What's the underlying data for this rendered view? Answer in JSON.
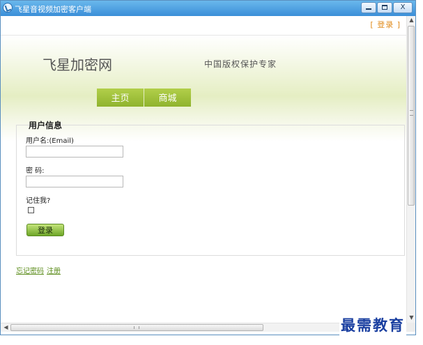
{
  "window": {
    "title": "飞星音视频加密客户端",
    "close_glyph": "X"
  },
  "header": {
    "login_link": "[ 登录 ]",
    "site_title": "飞星加密网",
    "slogan": "中国版权保护专家",
    "nav": [
      {
        "label": "主页"
      },
      {
        "label": "商城"
      }
    ]
  },
  "form": {
    "legend": "用户信息",
    "username_label": "用户名:(Email)",
    "username_value": "",
    "password_label": "密 码:",
    "password_value": "",
    "remember_label": "记住我?",
    "remember_checked": false,
    "login_button": "登录"
  },
  "links": {
    "forgot_password": "忘记密码",
    "register": "注册"
  },
  "scrollbars": {
    "up": "▲",
    "down": "▼",
    "left": "◀",
    "right": "▶"
  },
  "watermark": "最需教育",
  "colors": {
    "accent_green": "#8fb32e",
    "link_orange": "#e08a1a",
    "link_green": "#5b8c1a",
    "titlebar_blue": "#3a8ed8"
  }
}
